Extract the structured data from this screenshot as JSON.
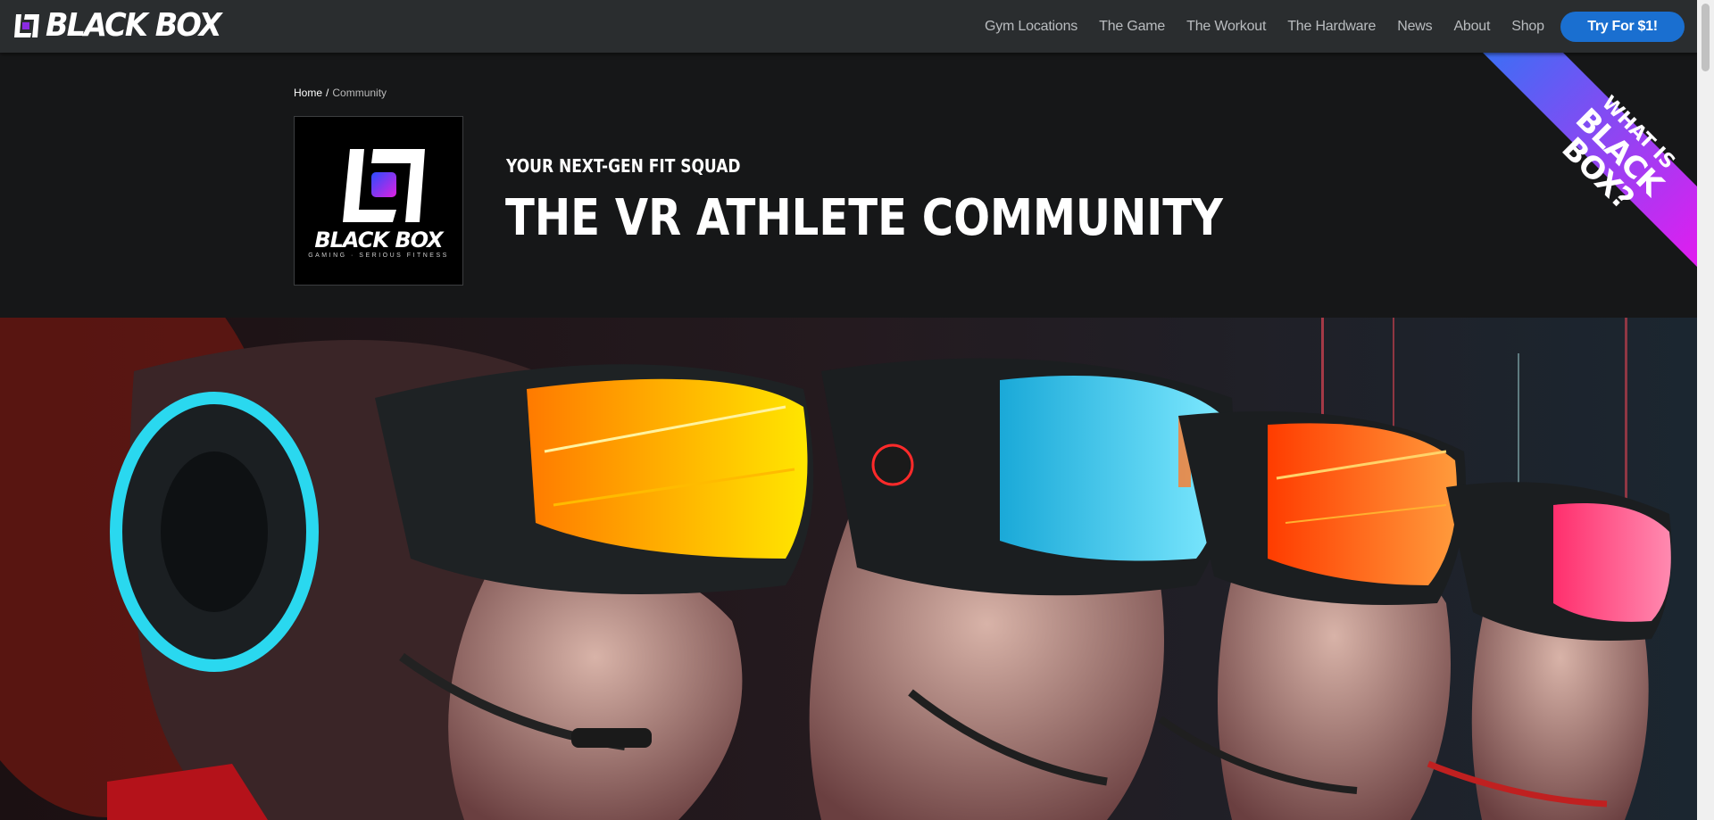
{
  "nav": {
    "brand": "BLACK BOX",
    "links": [
      {
        "label": "Gym Locations"
      },
      {
        "label": "The Game"
      },
      {
        "label": "The Workout"
      },
      {
        "label": "The Hardware"
      },
      {
        "label": "News"
      },
      {
        "label": "About"
      },
      {
        "label": "Shop"
      }
    ],
    "cta_label": "Try For $1!"
  },
  "breadcrumb": {
    "home": "Home",
    "separator": "/",
    "current": "Community"
  },
  "header": {
    "logo_box": {
      "brand": "BLACK BOX",
      "tagline": "GAMING · SERIOUS FITNESS"
    },
    "eyebrow": "YOUR NEXT-GEN FIT SQUAD",
    "title": "THE VR ATHLETE COMMUNITY"
  },
  "ribbon": {
    "line1": "WHAT IS",
    "line2": "BLACK BOX?"
  },
  "colors": {
    "nav_bg": "#2a2d2f",
    "page_bg": "#161718",
    "cta_blue": "#1a6fd0",
    "ribbon_start": "#3b6ff5",
    "ribbon_end": "#e21cf0"
  }
}
